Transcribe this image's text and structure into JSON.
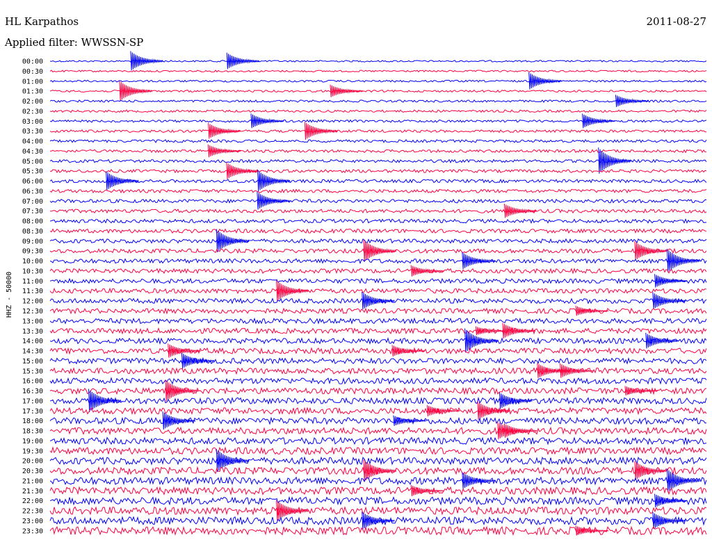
{
  "header": {
    "station": "HL Karpathos",
    "date": "2011-08-27",
    "filter": "Applied filter: WWSSN-SP"
  },
  "axis": {
    "channel_label": "HHZ - 50000"
  },
  "traces": {
    "labels": [
      "00:00",
      "00:30",
      "01:00",
      "01:30",
      "02:00",
      "02:30",
      "03:00",
      "03:30",
      "04:00",
      "04:30",
      "05:00",
      "05:30",
      "06:00",
      "06:30",
      "07:00",
      "07:30",
      "08:00",
      "08:30",
      "09:00",
      "09:30",
      "10:00",
      "10:30",
      "11:00",
      "11:30",
      "12:00",
      "12:30",
      "13:00",
      "13:30",
      "14:00",
      "14:30",
      "15:00",
      "15:30",
      "16:00",
      "16:30",
      "17:00",
      "17:30",
      "18:00",
      "18:30",
      "19:00",
      "19:30",
      "20:00",
      "20:30",
      "21:00",
      "21:30",
      "22:00",
      "22:30",
      "23:00",
      "23:30"
    ],
    "colors": [
      "#0000ff",
      "#ff0040"
    ]
  }
}
